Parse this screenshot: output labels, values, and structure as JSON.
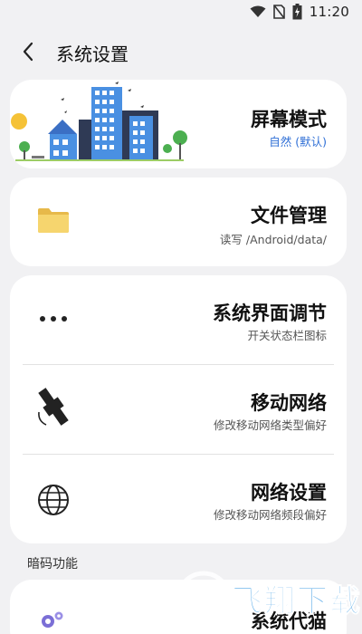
{
  "status": {
    "time": "11:20"
  },
  "header": {
    "title": "系统设置"
  },
  "items": [
    {
      "title": "屏幕模式",
      "subtitle": "自然 (默认)"
    },
    {
      "title": "文件管理",
      "subtitle": "读写 /Android/data/"
    },
    {
      "title": "系统界面调节",
      "subtitle": "开关状态栏图标"
    },
    {
      "title": "移动网络",
      "subtitle": "修改移动网络类型偏好"
    },
    {
      "title": "网络设置",
      "subtitle": "修改移动网络频段偏好"
    }
  ],
  "section": {
    "label": "暗码功能"
  },
  "partial_item": {
    "title": "系统代猫"
  },
  "watermark": {
    "text": "飞翔下载"
  },
  "colors": {
    "background": "#f1f1f3",
    "card": "#ffffff",
    "accent_blue": "#2f6fd6",
    "folder": "#f3d36b"
  }
}
